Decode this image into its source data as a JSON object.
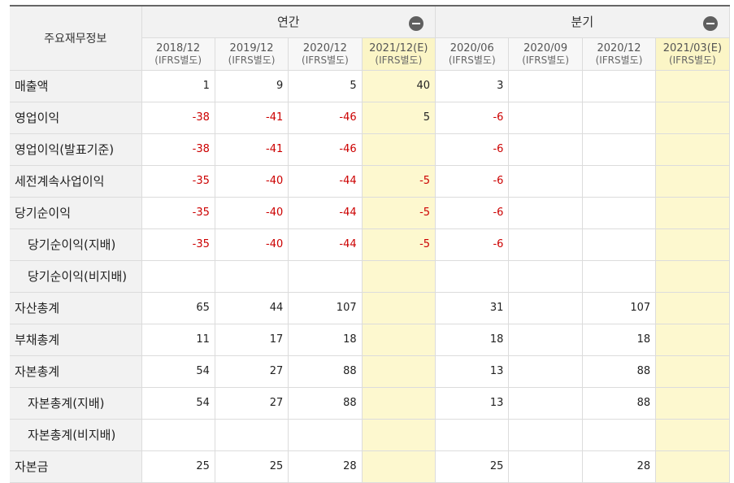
{
  "header": {
    "label": "주요재무정보",
    "annual_label": "연간",
    "quarter_label": "분기",
    "annual_periods": [
      {
        "date": "2018/12",
        "note": "(IFRS별도)",
        "est": false
      },
      {
        "date": "2019/12",
        "note": "(IFRS별도)",
        "est": false
      },
      {
        "date": "2020/12",
        "note": "(IFRS별도)",
        "est": false
      },
      {
        "date": "2021/12(E)",
        "note": "(IFRS별도)",
        "est": true
      }
    ],
    "quarter_periods": [
      {
        "date": "2020/06",
        "note": "(IFRS별도)",
        "est": false
      },
      {
        "date": "2020/09",
        "note": "(IFRS별도)",
        "est": false
      },
      {
        "date": "2020/12",
        "note": "(IFRS별도)",
        "est": false
      },
      {
        "date": "2021/03(E)",
        "note": "(IFRS별도)",
        "est": true
      }
    ]
  },
  "rows": [
    {
      "label": "매출액",
      "indent": false,
      "values": [
        "1",
        "9",
        "5",
        "40",
        "3",
        "",
        "",
        ""
      ]
    },
    {
      "label": "영업이익",
      "indent": false,
      "values": [
        "-38",
        "-41",
        "-46",
        "5",
        "-6",
        "",
        "",
        ""
      ]
    },
    {
      "label": "영업이익(발표기준)",
      "indent": false,
      "values": [
        "-38",
        "-41",
        "-46",
        "",
        "-6",
        "",
        "",
        ""
      ]
    },
    {
      "label": "세전계속사업이익",
      "indent": false,
      "values": [
        "-35",
        "-40",
        "-44",
        "-5",
        "-6",
        "",
        "",
        ""
      ]
    },
    {
      "label": "당기순이익",
      "indent": false,
      "values": [
        "-35",
        "-40",
        "-44",
        "-5",
        "-6",
        "",
        "",
        ""
      ]
    },
    {
      "label": "당기순이익(지배)",
      "indent": true,
      "values": [
        "-35",
        "-40",
        "-44",
        "-5",
        "-6",
        "",
        "",
        ""
      ]
    },
    {
      "label": "당기순이익(비지배)",
      "indent": true,
      "values": [
        "",
        "",
        "",
        "",
        "",
        "",
        "",
        ""
      ]
    },
    {
      "label": "자산총계",
      "indent": false,
      "values": [
        "65",
        "44",
        "107",
        "",
        "31",
        "",
        "107",
        ""
      ]
    },
    {
      "label": "부채총계",
      "indent": false,
      "values": [
        "11",
        "17",
        "18",
        "",
        "18",
        "",
        "18",
        ""
      ]
    },
    {
      "label": "자본총계",
      "indent": false,
      "values": [
        "54",
        "27",
        "88",
        "",
        "13",
        "",
        "88",
        ""
      ]
    },
    {
      "label": "자본총계(지배)",
      "indent": true,
      "values": [
        "54",
        "27",
        "88",
        "",
        "13",
        "",
        "88",
        ""
      ]
    },
    {
      "label": "자본총계(비지배)",
      "indent": true,
      "values": [
        "",
        "",
        "",
        "",
        "",
        "",
        "",
        ""
      ]
    },
    {
      "label": "자본금",
      "indent": false,
      "values": [
        "25",
        "25",
        "28",
        "",
        "25",
        "",
        "28",
        ""
      ]
    }
  ],
  "colors": {
    "negative": "#cc0000",
    "estimate_bg": "#fdf8cf",
    "header_bg": "#f2f2f2"
  }
}
